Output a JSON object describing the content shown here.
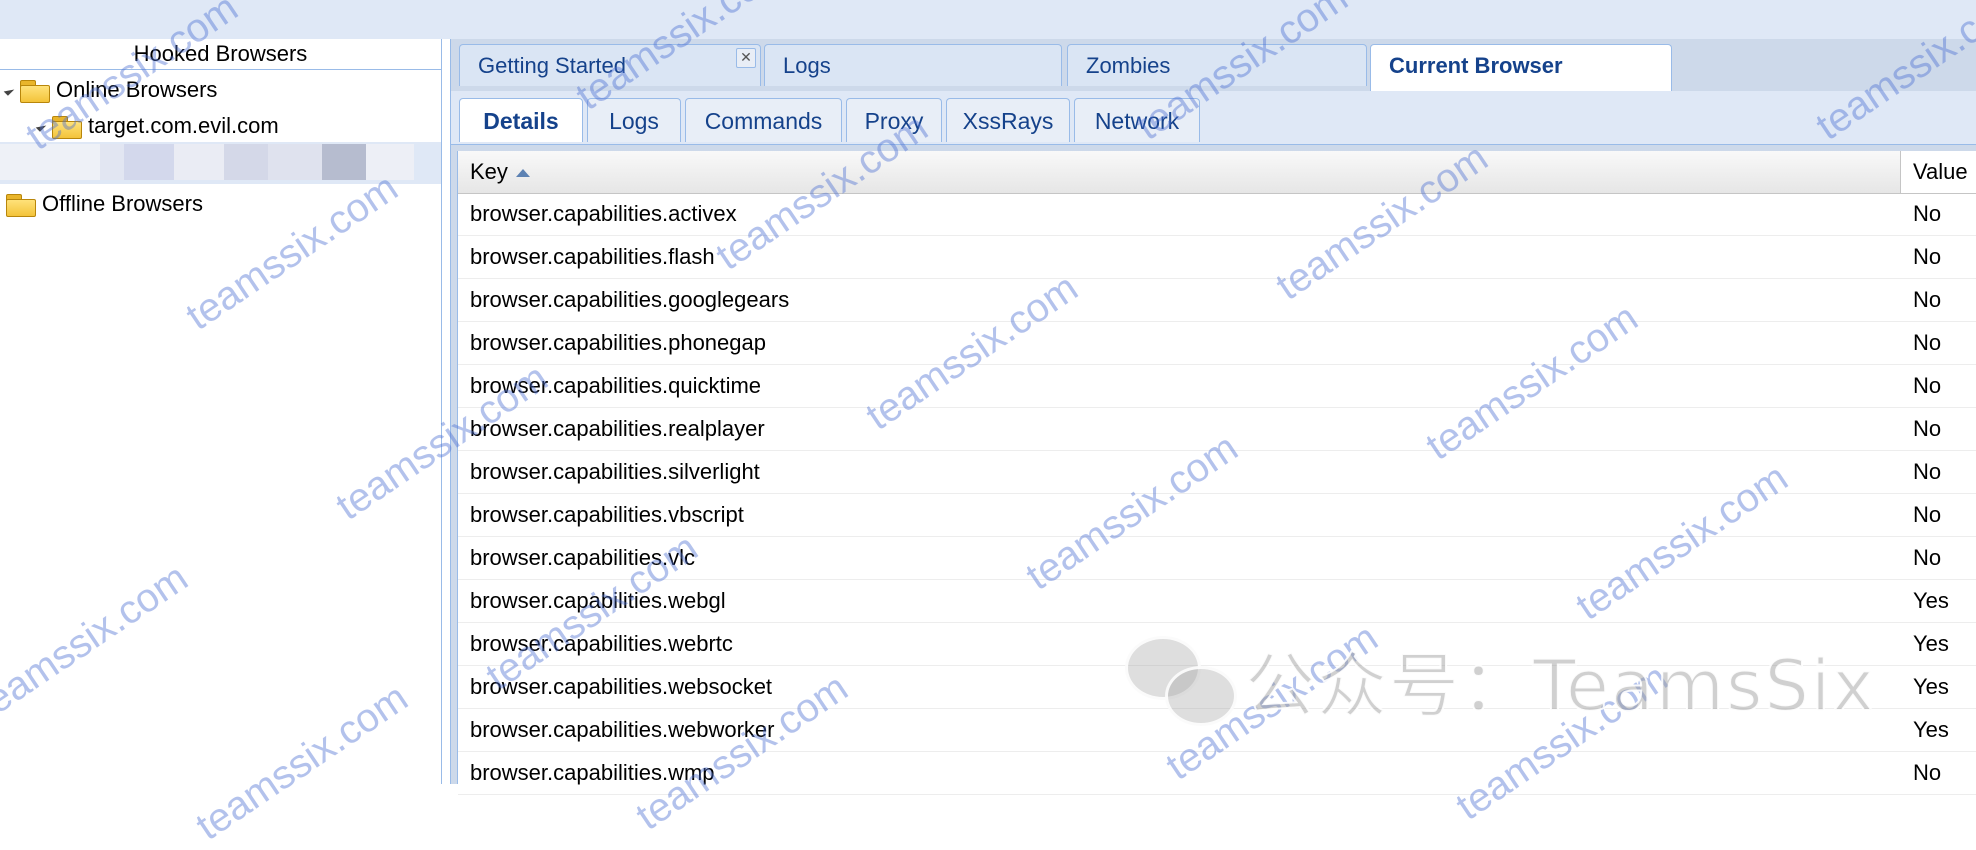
{
  "left_panel": {
    "title": "Hooked Browsers",
    "tree": {
      "online": "Online Browsers",
      "target": "target.com.evil.com",
      "offline": "Offline Browsers"
    }
  },
  "main_tabs": [
    {
      "label": "Getting Started",
      "closable": true
    },
    {
      "label": "Logs"
    },
    {
      "label": "Zombies"
    },
    {
      "label": "Current Browser",
      "active": true
    }
  ],
  "sub_tabs": [
    {
      "label": "Details",
      "active": true
    },
    {
      "label": "Logs"
    },
    {
      "label": "Commands"
    },
    {
      "label": "Proxy"
    },
    {
      "label": "XssRays"
    },
    {
      "label": "Network"
    }
  ],
  "grid": {
    "columns": {
      "key": "Key",
      "value": "Value"
    },
    "rows": [
      {
        "key": "browser.capabilities.activex",
        "value": "No"
      },
      {
        "key": "browser.capabilities.flash",
        "value": "No"
      },
      {
        "key": "browser.capabilities.googlegears",
        "value": "No"
      },
      {
        "key": "browser.capabilities.phonegap",
        "value": "No"
      },
      {
        "key": "browser.capabilities.quicktime",
        "value": "No"
      },
      {
        "key": "browser.capabilities.realplayer",
        "value": "No"
      },
      {
        "key": "browser.capabilities.silverlight",
        "value": "No"
      },
      {
        "key": "browser.capabilities.vbscript",
        "value": "No"
      },
      {
        "key": "browser.capabilities.vlc",
        "value": "No"
      },
      {
        "key": "browser.capabilities.webgl",
        "value": "Yes"
      },
      {
        "key": "browser.capabilities.webrtc",
        "value": "Yes"
      },
      {
        "key": "browser.capabilities.websocket",
        "value": "Yes"
      },
      {
        "key": "browser.capabilities.webworker",
        "value": "Yes"
      },
      {
        "key": "browser.capabilities.wmp",
        "value": "No"
      }
    ]
  },
  "watermark": {
    "text": "teamssix.com",
    "wechat_label": "公众号：TeamsSix"
  }
}
